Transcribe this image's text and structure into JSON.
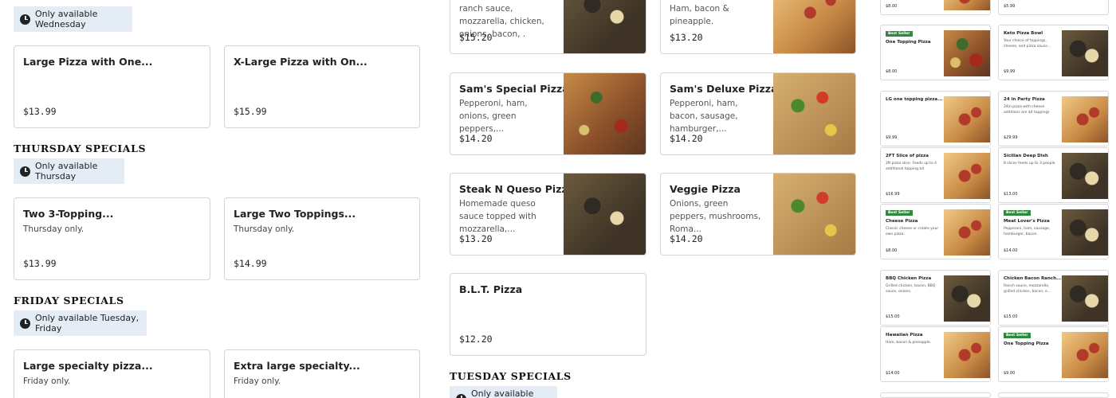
{
  "left": {
    "wednesday_chip": "Only available Wednesday",
    "wednesday_cards": [
      {
        "title": "Large Pizza with One...",
        "price": "$13.99"
      },
      {
        "title": "X-Large Pizza with On...",
        "price": "$15.99"
      }
    ],
    "thursday": {
      "heading": "THURSDAY SPECIALS",
      "chip": "Only available Thursday",
      "cards": [
        {
          "title": "Two 3-Topping...",
          "sub": "Thursday only.",
          "price": "$13.99"
        },
        {
          "title": "Large Two Toppings...",
          "sub": "Thursday only.",
          "price": "$14.99"
        }
      ]
    },
    "friday": {
      "heading": "FRIDAY SPECIALS",
      "chip": "Only available Tuesday, Friday",
      "cards": [
        {
          "title": "Large specialty pizza...",
          "sub": "Friday only."
        },
        {
          "title": "Extra large specialty...",
          "sub": "Friday only."
        }
      ]
    }
  },
  "middle": {
    "top_items": [
      {
        "desc": "ranch sauce, mozzarella, chicken, onions, bacon, .",
        "price": "$15.20"
      },
      {
        "desc": "Ham, bacon & pineapple.",
        "price": "$13.20"
      }
    ],
    "items": [
      {
        "title": "Sam's Special Pizza",
        "desc": "Pepperoni, ham, onions, green peppers,...",
        "price": "$14.20"
      },
      {
        "title": "Sam's Deluxe Pizza",
        "desc": "Pepperoni, ham, bacon, sausage, hamburger,...",
        "price": "$14.20"
      },
      {
        "title": "Steak N Queso Pizza",
        "desc": "Homemade queso sauce topped with mozzarella,...",
        "price": "$13.20"
      },
      {
        "title": "Veggie Pizza",
        "desc": "Onions, green peppers, mushrooms, Roma...",
        "price": "$14.20"
      },
      {
        "title": "B.L.T. Pizza",
        "desc": "",
        "price": "$12.20"
      }
    ],
    "tuesday": {
      "heading": "TUESDAY SPECIALS",
      "chip": "Only available Tuesday"
    }
  },
  "right": {
    "top_prices": [
      "$8.00",
      "$5.99"
    ],
    "cards": [
      {
        "badge": "Best Seller",
        "title": "One Topping Pizza",
        "desc": "",
        "price": "$8.00"
      },
      {
        "badge": "",
        "title": "Keto Pizza Bowl",
        "desc": "Your choice of toppings, cheese, and pizza sauce...",
        "price": "$9.99"
      },
      {
        "badge": "",
        "title": "LG one topping pizza...",
        "desc": "",
        "price": "$9.99"
      },
      {
        "badge": "",
        "title": "24 in Party Pizza",
        "desc": "24in pizza with cheese additions are $4 toppings",
        "price": "$29.99"
      },
      {
        "badge": "",
        "title": "2FT Slice of pizza",
        "desc": "2ft pizza slice. Feeds up to 4 additional topping $4",
        "price": "$16.99"
      },
      {
        "badge": "",
        "title": "Sicilian Deep Dish",
        "desc": "8 slices feeds up to 3 people",
        "price": "$13.00"
      },
      {
        "badge": "Best Seller",
        "title": "Cheese Pizza",
        "desc": "Classic cheese or create your own pizza.",
        "price": "$8.00"
      },
      {
        "badge": "Best Seller",
        "title": "Meat Lover's Pizza",
        "desc": "Pepperoni, ham, sausage, hamburger, bacon.",
        "price": "$14.00"
      },
      {
        "badge": "",
        "title": "BBQ Chicken Pizza",
        "desc": "Grilled chicken, bacon, BBQ sauce, onions.",
        "price": "$15.00"
      },
      {
        "badge": "",
        "title": "Chicken Bacon Ranch...",
        "desc": "Ranch sauce, mozzarella, grilled chicken, bacon, o...",
        "price": "$15.00"
      },
      {
        "badge": "",
        "title": "Hawaiian Pizza",
        "desc": "Ham, bacon & pineapple.",
        "price": "$14.00"
      },
      {
        "badge": "Best Seller",
        "title": "One Topping Pizza",
        "desc": "",
        "price": "$9.00"
      }
    ]
  }
}
